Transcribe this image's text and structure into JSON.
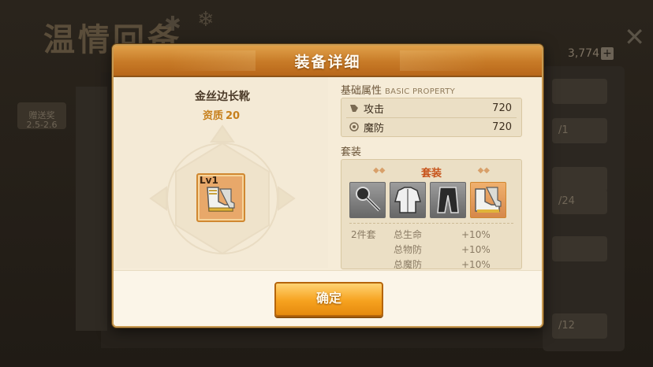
{
  "background": {
    "title": "温情回备",
    "currency": "3,774",
    "plus": "+",
    "close": "✕",
    "left_tabs": [
      "赠送奖",
      "2.5-2.6"
    ],
    "right_rows": [
      "",
      "/1",
      "",
      "/24",
      "",
      "/12"
    ]
  },
  "modal": {
    "title": "装备详细",
    "item": {
      "name": "金丝边长靴",
      "quality_label": "资质",
      "quality_value": "20",
      "level": "Lv1",
      "icon": "boots-icon"
    },
    "basic_property": {
      "label": "基础属性",
      "sublabel": "BASIC PROPERTY",
      "stats": [
        {
          "name": "攻击",
          "value": "720",
          "icon": "attack-icon"
        },
        {
          "name": "魔防",
          "value": "720",
          "icon": "magic-defense-icon"
        }
      ]
    },
    "set": {
      "label": "套装",
      "title": "套装",
      "pieces": [
        {
          "icon": "key-staff-icon",
          "active": false
        },
        {
          "icon": "jacket-icon",
          "active": false
        },
        {
          "icon": "pants-icon",
          "active": false
        },
        {
          "icon": "boots-icon",
          "active": true
        }
      ],
      "bonus_count": "2件套",
      "bonuses": [
        {
          "name": "总生命",
          "value": "+10%"
        },
        {
          "name": "总物防",
          "value": "+10%"
        },
        {
          "name": "总魔防",
          "value": "+10%"
        }
      ]
    },
    "confirm_label": "确定"
  },
  "colors": {
    "accent": "#c77a27",
    "quality": "#c7801c",
    "set_title": "#c7541c",
    "button": "#f6a21f"
  }
}
